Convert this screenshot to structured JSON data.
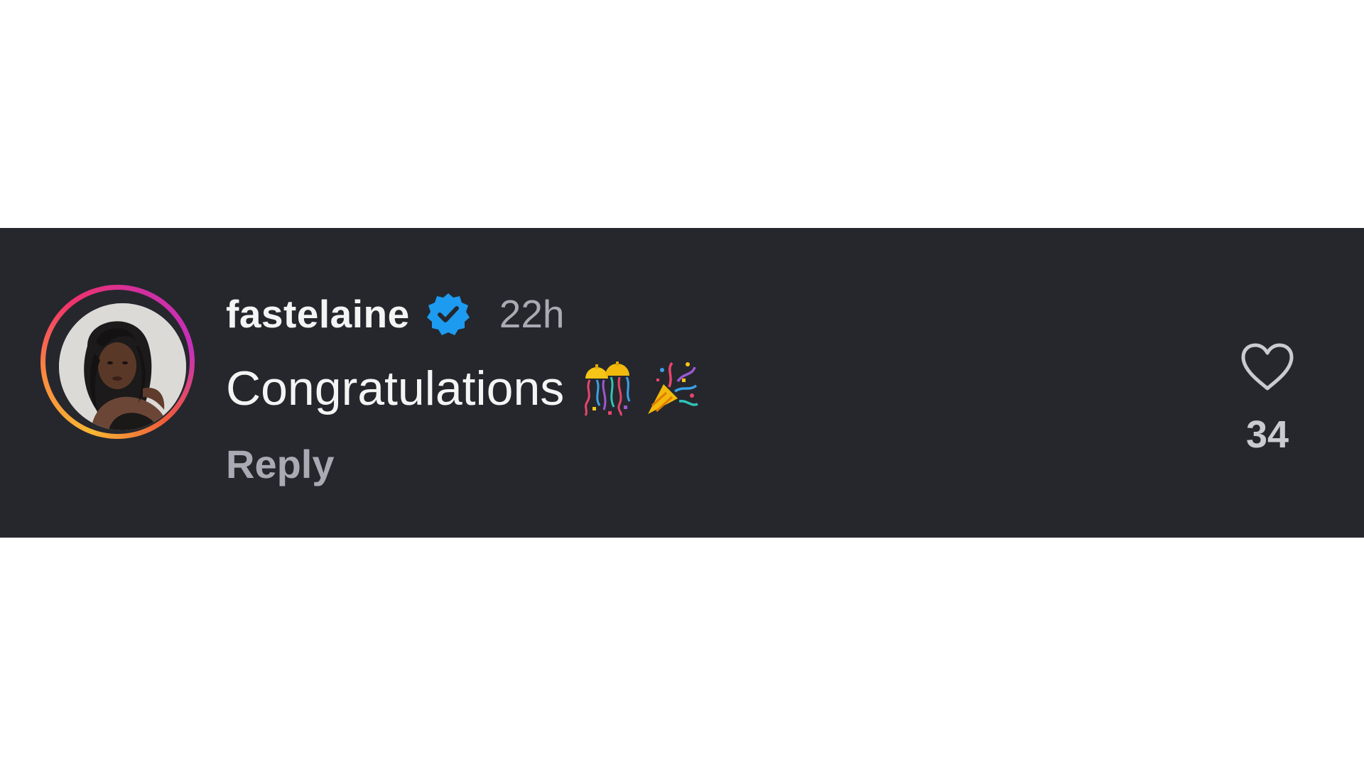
{
  "comment": {
    "username": "fastelaine",
    "verified": true,
    "timestamp": "22h",
    "text": "Congratulations",
    "emojis": [
      "confetti-ball",
      "party-popper"
    ],
    "reply_label": "Reply",
    "like_count": "34"
  },
  "colors": {
    "card_background": "#25272d",
    "page_background": "#ffffff",
    "verified_badge": "#1d9bf0",
    "username_text": "#f4f4f5",
    "muted_text": "#a8abb3"
  },
  "icons": {
    "verified": "verified-badge-icon",
    "like": "heart-outline-icon",
    "emoji_1": "confetti-ball-icon",
    "emoji_2": "party-popper-icon"
  }
}
